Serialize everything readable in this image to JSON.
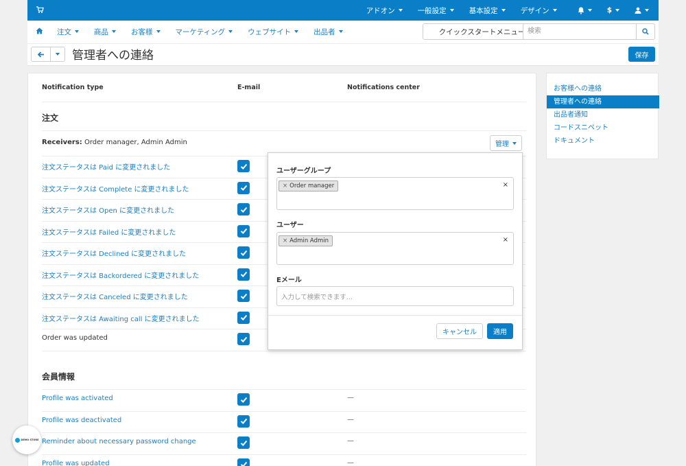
{
  "topbar": {
    "cart_icon": "cart-icon",
    "items": [
      "アドオン",
      "一般設定",
      "基本設定",
      "デザイン"
    ],
    "currency": "$",
    "bell_icon": "bell-icon",
    "user_icon": "user-icon"
  },
  "mainnav": {
    "home_icon": "home-icon",
    "items": [
      "注文",
      "商品",
      "お客様",
      "マーケティング",
      "ウェブサイト",
      "出品者"
    ]
  },
  "quickstart": "クイックスタートメニュー",
  "search": {
    "placeholder": "検索"
  },
  "page": {
    "title": "管理者への連絡",
    "save": "保存"
  },
  "sidebar": {
    "items": [
      "お客様への連絡",
      "管理者への連絡",
      "出品者通知",
      "コードスニペット",
      "ドキュメント"
    ],
    "active_index": 1
  },
  "table": {
    "headers": {
      "type": "Notification type",
      "email": "E-mail",
      "center": "Notifications center"
    }
  },
  "orders": {
    "title": "注文",
    "receivers_label": "Receivers:",
    "receivers_value": " Order manager, Admin Admin",
    "manage": "管理",
    "rows": [
      {
        "label": "注文ステータスは Paid に変更されました",
        "email": true
      },
      {
        "label": "注文ステータスは Complete に変更されました",
        "email": true
      },
      {
        "label": "注文ステータスは Open に変更されました",
        "email": true
      },
      {
        "label": "注文ステータスは Failed に変更されました",
        "email": true
      },
      {
        "label": "注文ステータスは Declined に変更されました",
        "email": true
      },
      {
        "label": "注文ステータスは Backordered に変更されました",
        "email": true
      },
      {
        "label": "注文ステータスは Canceled に変更されました",
        "email": true
      },
      {
        "label": "注文ステータスは Awaiting call に変更されました",
        "email": true
      },
      {
        "label": "Order was updated",
        "email": true
      }
    ]
  },
  "members": {
    "title": "会員情報",
    "rows": [
      {
        "label": "Profile was activated",
        "email": true,
        "center": "—"
      },
      {
        "label": "Profile was deactivated",
        "email": true,
        "center": "—"
      },
      {
        "label": "Reminder about necessary password change",
        "email": true,
        "center": "—"
      },
      {
        "label": "Profile was updated",
        "email": true,
        "center": "—"
      }
    ]
  },
  "popover": {
    "group_label": "ユーザーグループ",
    "group_tag": "Order manager",
    "user_label": "ユーザー",
    "user_tag": "Admin Admin",
    "email_label": "Eメール",
    "email_placeholder": "入力して検索できます...",
    "tag_remove": "×",
    "clear": "×",
    "cancel": "キャンセル",
    "apply": "適用"
  },
  "badge": {
    "text": "DEMO STORE"
  },
  "colors": {
    "primary": "#0a7fc7",
    "link": "#1c7fc1"
  }
}
